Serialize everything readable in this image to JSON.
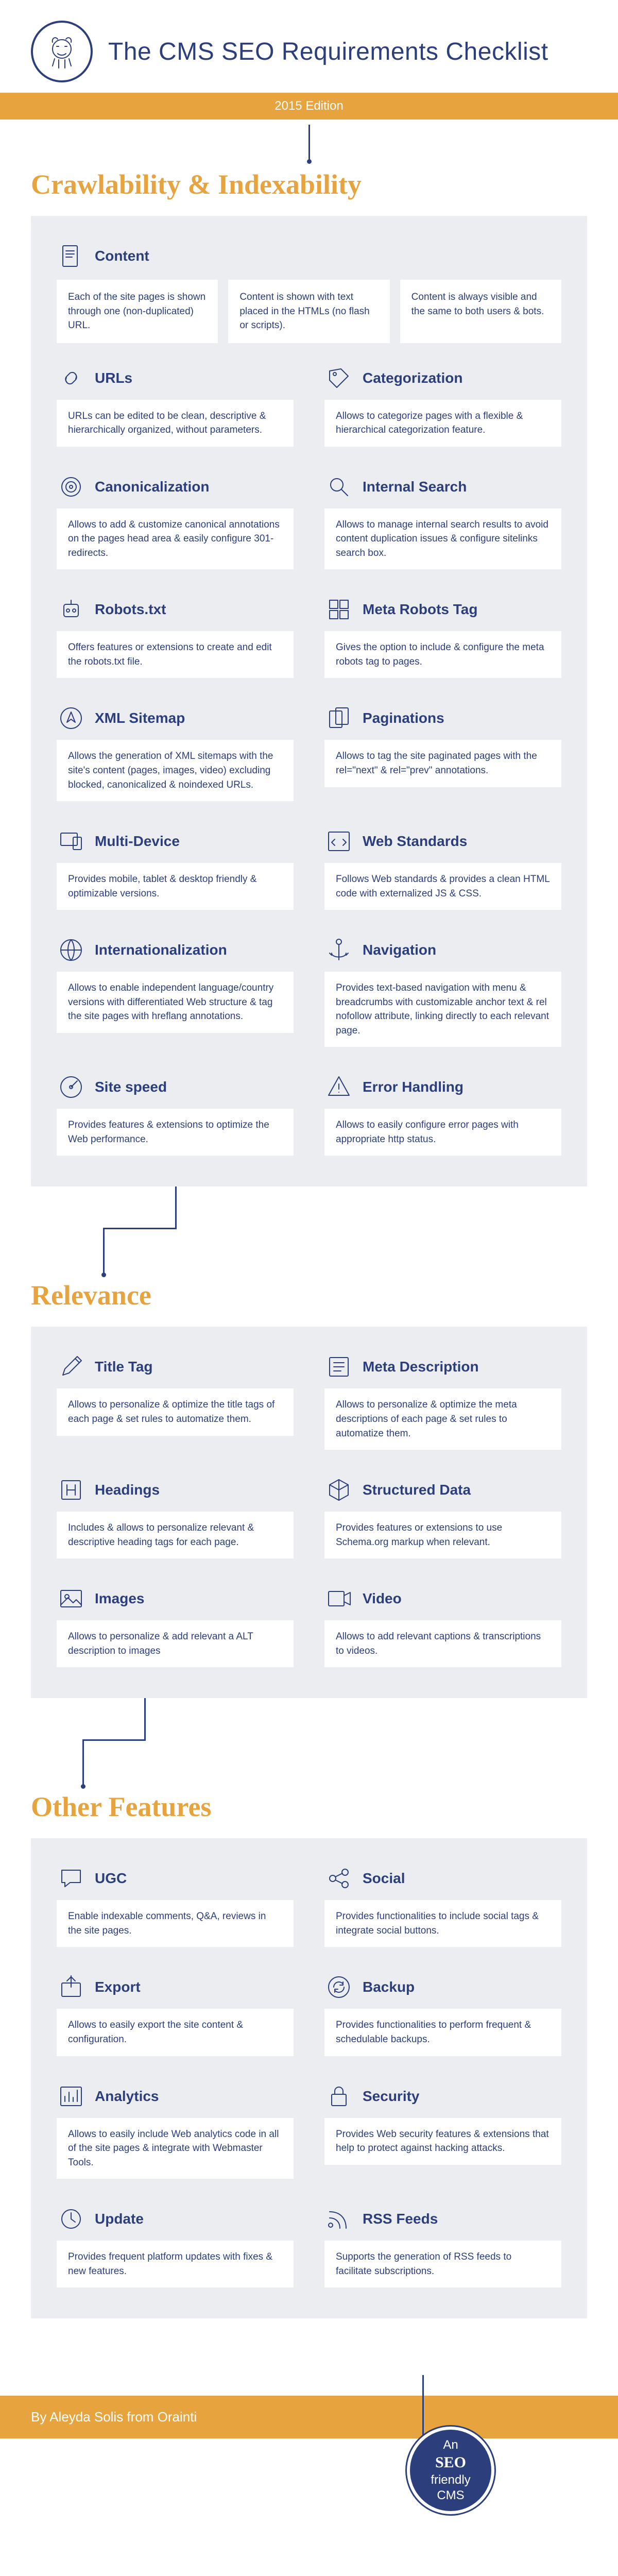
{
  "header": {
    "title": "The CMS SEO Requirements Checklist",
    "edition": "2015 Edition"
  },
  "sections": {
    "crawlability": {
      "heading": "Crawlability & Indexability",
      "content": {
        "title": "Content",
        "cells": [
          "Each of the site pages is shown through one (non-duplicated) URL.",
          "Content is shown with text placed in the HTMLs (no flash or scripts).",
          "Content is always visible and  the same to both users & bots."
        ]
      },
      "items": [
        {
          "title": "URLs",
          "desc": "URLs can be edited to be clean, descriptive & hierarchically organized, without parameters."
        },
        {
          "title": "Categorization",
          "desc": "Allows to categorize pages with a flexible & hierarchical categorization feature."
        },
        {
          "title": "Canonicalization",
          "desc": "Allows to add & customize canonical annotations on the pages head area & easily configure 301-redirects."
        },
        {
          "title": "Internal Search",
          "desc": "Allows to manage internal search results to avoid content duplication issues & configure sitelinks search box."
        },
        {
          "title": "Robots.txt",
          "desc": "Offers features or extensions to create and edit the robots.txt file."
        },
        {
          "title": "Meta Robots Tag",
          "desc": "Gives the option to include & configure the meta robots tag to pages."
        },
        {
          "title": "XML Sitemap",
          "desc": "Allows the generation of XML sitemaps with the site's content (pages, images, video) excluding blocked, canonicalized & noindexed URLs."
        },
        {
          "title": "Paginations",
          "desc": "Allows to tag the site paginated pages with the rel=\"next\" & rel=\"prev\" annotations."
        },
        {
          "title": "Multi-Device",
          "desc": "Provides mobile, tablet & desktop friendly & optimizable versions."
        },
        {
          "title": "Web Standards",
          "desc": "Follows Web standards & provides a clean HTML code with externalized JS & CSS."
        },
        {
          "title": "Internationalization",
          "desc": "Allows to enable independent language/country versions with differentiated Web structure & tag the site pages with hreflang annotations."
        },
        {
          "title": "Navigation",
          "desc": "Provides text-based navigation with menu & breadcrumbs with customizable anchor text & rel nofollow attribute, linking directly to each relevant page."
        },
        {
          "title": "Site speed",
          "desc": "Provides features & extensions to optimize the Web performance."
        },
        {
          "title": "Error Handling",
          "desc": "Allows to easily configure error pages with appropriate http status."
        }
      ]
    },
    "relevance": {
      "heading": "Relevance",
      "items": [
        {
          "title": "Title Tag",
          "desc": "Allows to personalize & optimize the title tags of each page & set rules to automatize them."
        },
        {
          "title": "Meta Description",
          "desc": "Allows to personalize & optimize the meta descriptions of each page & set rules to automatize them."
        },
        {
          "title": "Headings",
          "desc": "Includes & allows to personalize relevant & descriptive  heading tags for each page."
        },
        {
          "title": "Structured Data",
          "desc": "Provides features or extensions to use Schema.org markup when relevant."
        },
        {
          "title": "Images",
          "desc": "Allows to personalize & add relevant a ALT description to images"
        },
        {
          "title": "Video",
          "desc": "Allows to add relevant captions  & transcriptions to videos."
        }
      ]
    },
    "other": {
      "heading": "Other Features",
      "items": [
        {
          "title": "UGC",
          "desc": "Enable indexable comments, Q&A, reviews in the site pages."
        },
        {
          "title": "Social",
          "desc": "Provides functionalities to include social tags & integrate social buttons."
        },
        {
          "title": "Export",
          "desc": "Allows to easily export the site content & configuration."
        },
        {
          "title": "Backup",
          "desc": "Provides functionalities to perform frequent & schedulable backups."
        },
        {
          "title": "Analytics",
          "desc": "Allows to easily include Web analytics code in all of the site pages & integrate with Webmaster Tools."
        },
        {
          "title": "Security",
          "desc": "Provides  Web security features & extensions that help to protect against hacking attacks."
        },
        {
          "title": "Update",
          "desc": "Provides frequent platform updates with fixes & new features."
        },
        {
          "title": "RSS Feeds",
          "desc": "Supports the generation of RSS feeds to facilitate subscriptions."
        }
      ]
    }
  },
  "footer": {
    "byline": "By Aleyda Solis from Orainti",
    "badge": {
      "line1": "An",
      "line2": "SEO",
      "line3": "friendly",
      "line4": "CMS"
    }
  }
}
